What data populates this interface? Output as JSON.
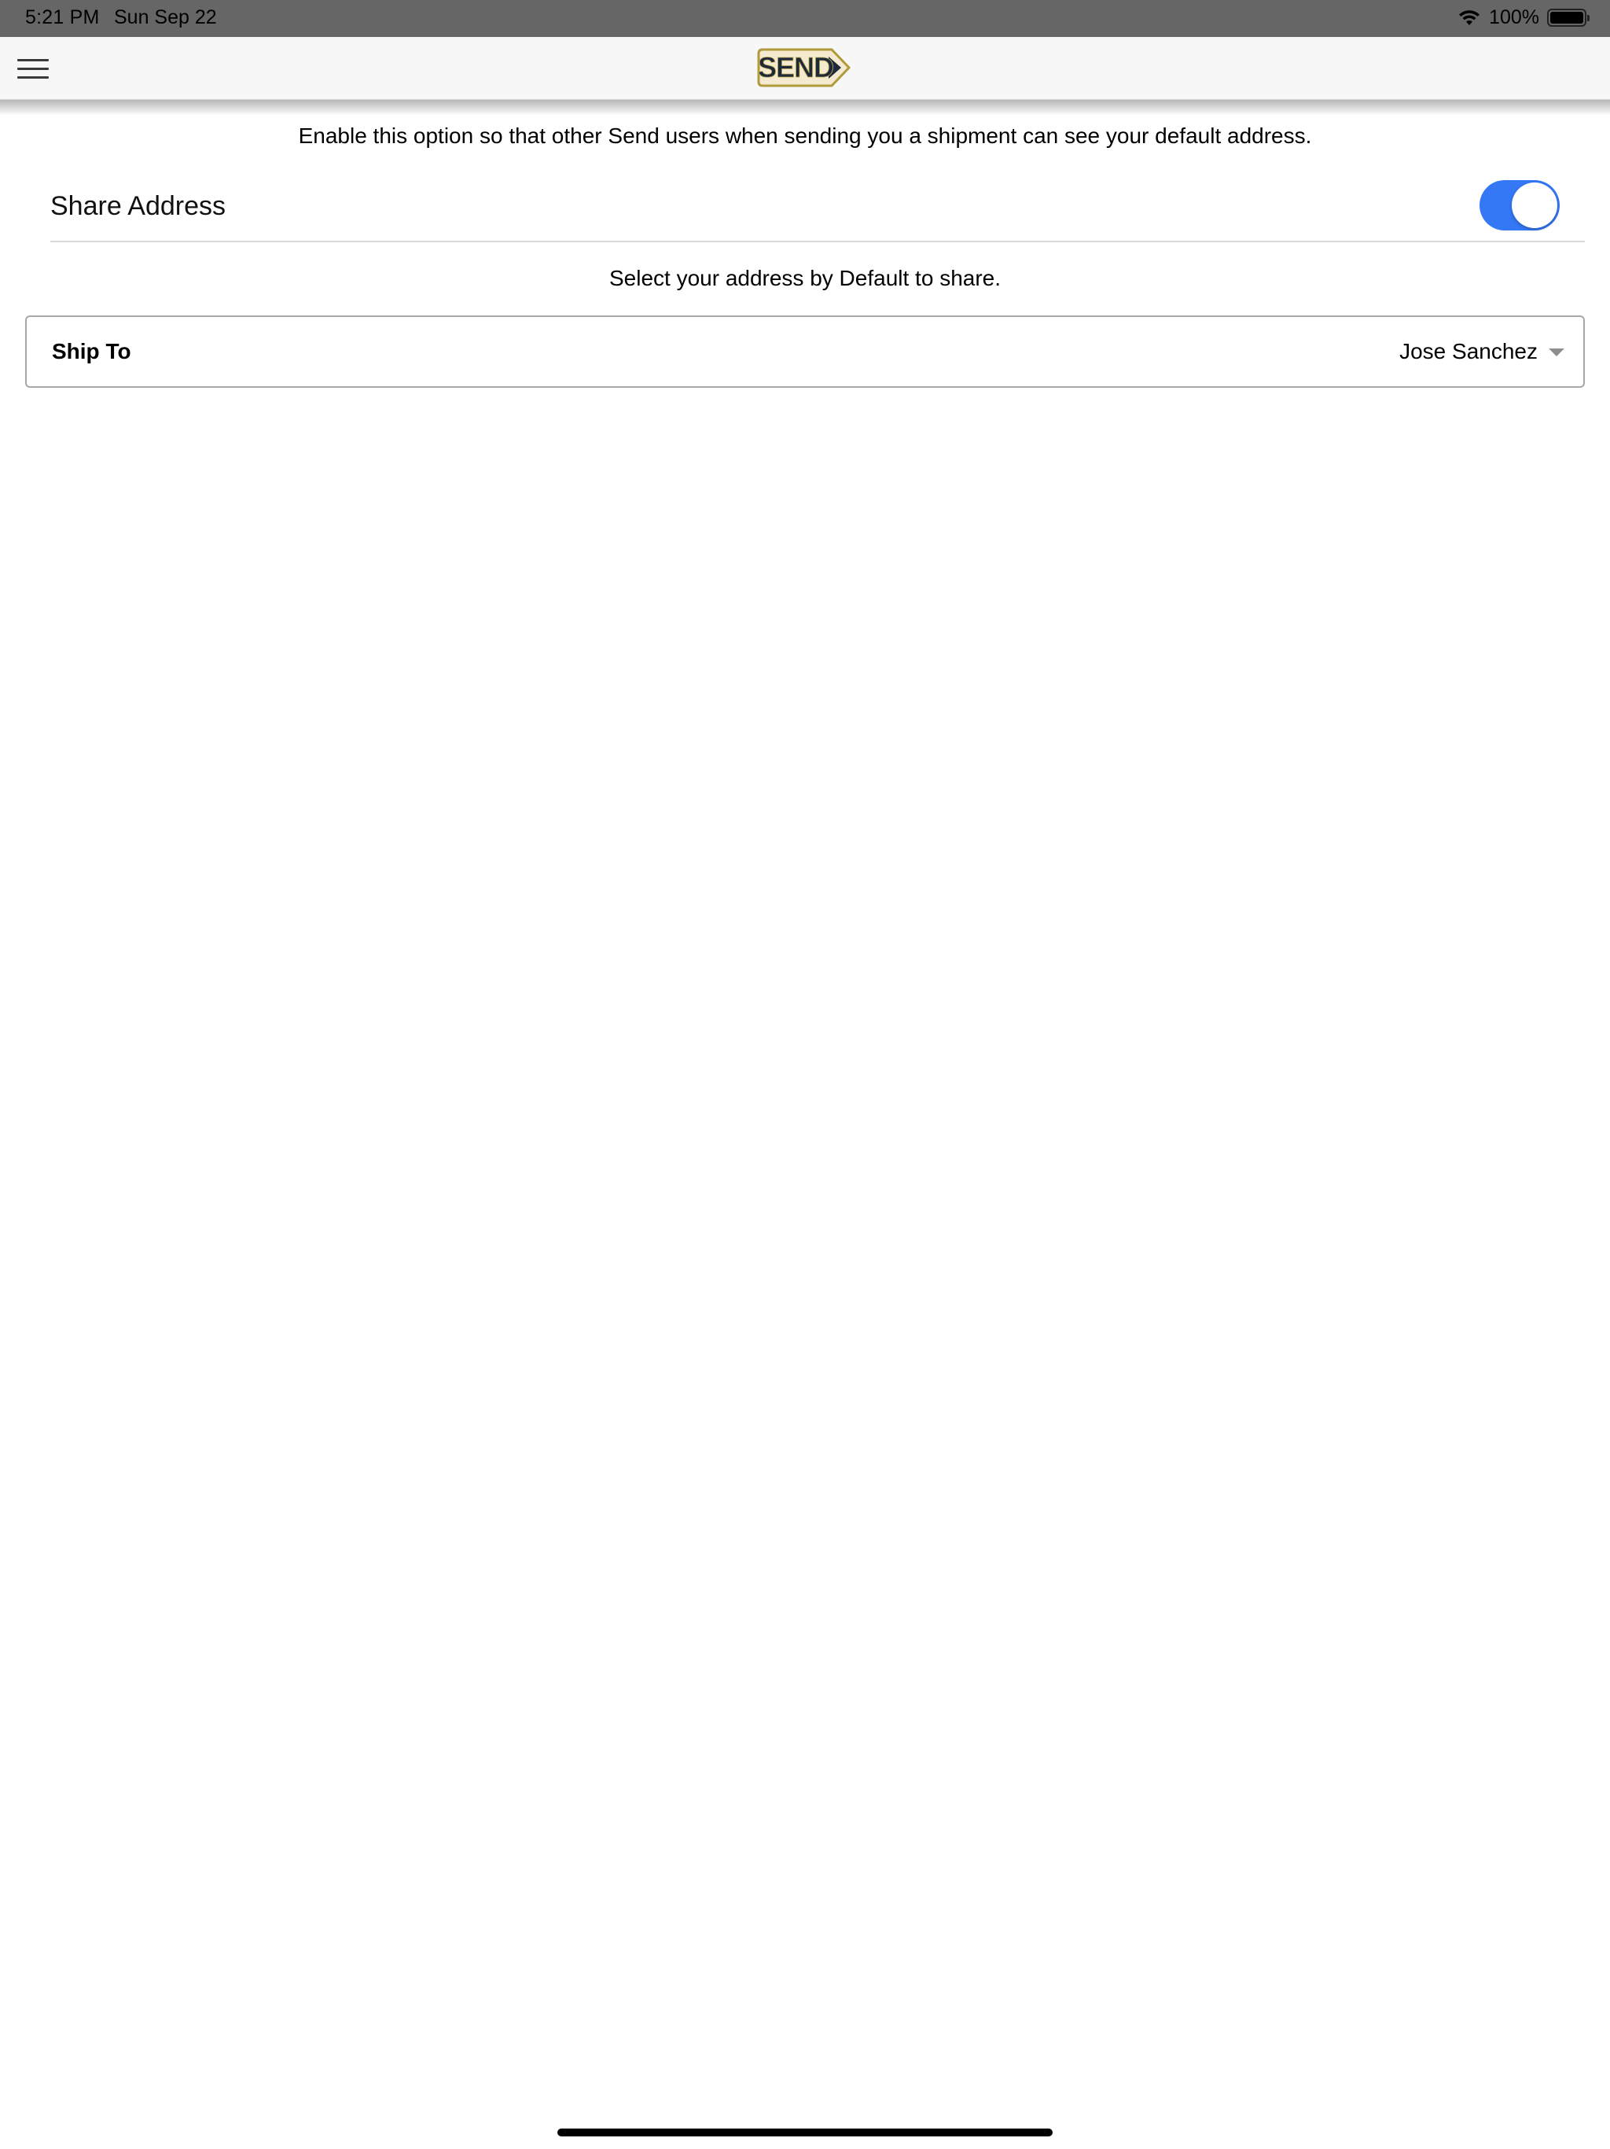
{
  "status_bar": {
    "time": "5:21 PM",
    "date": "Sun Sep 22",
    "battery": "100%",
    "battery_level": 1.0
  },
  "nav": {
    "menu_icon": "hamburger-menu-icon",
    "logo_text": "SEND"
  },
  "share": {
    "intro": "Enable this option so that other Send users when sending you a shipment can see your default address.",
    "label": "Share Address",
    "enabled": true,
    "toggle_color": "#3478f6"
  },
  "select_hint": "Select your address by Default to share.",
  "ship_to": {
    "label": "Ship To",
    "value": "Jose Sanchez"
  }
}
